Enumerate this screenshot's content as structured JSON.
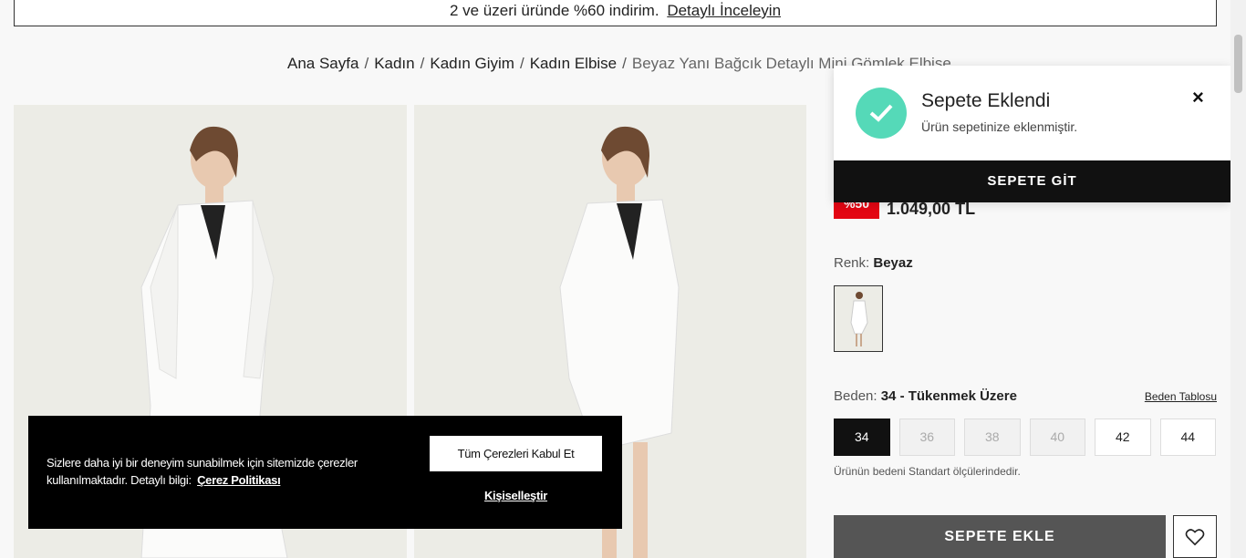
{
  "promo": {
    "text": "2 ve üzeri üründe %60 indirim.",
    "link": "Detaylı İnceleyin"
  },
  "breadcrumb": {
    "items": [
      "Ana Sayfa",
      "Kadın",
      "Kadın Giyim",
      "Kadın Elbise"
    ],
    "current": "Beyaz Yanı Bağcık Detaylı Mini Gömlek Elbise",
    "separator": "/"
  },
  "product": {
    "discount_badge": "%50",
    "price": "1.049,00 TL",
    "color_label": "Renk:",
    "color_value": "Beyaz",
    "size_label": "Beden:",
    "size_value": "34 - Tükenmek Üzere",
    "size_chart_link": "Beden Tablosu",
    "sizes": [
      {
        "label": "34",
        "state": "selected"
      },
      {
        "label": "36",
        "state": "disabled"
      },
      {
        "label": "38",
        "state": "disabled"
      },
      {
        "label": "40",
        "state": "disabled"
      },
      {
        "label": "42",
        "state": "available"
      },
      {
        "label": "44",
        "state": "available"
      }
    ],
    "size_note": "Ürünün bedeni Standart ölçülerindedir.",
    "add_to_cart": "SEPETE EKLE"
  },
  "toast": {
    "title": "Sepete Eklendi",
    "message": "Ürün sepetinize eklenmiştir.",
    "close": "×",
    "go_button": "SEPETE GİT"
  },
  "cookie": {
    "text": "Sizlere daha iyi bir deneyim sunabilmek için sitemizde çerezler kullanılmaktadır. Detaylı bilgi:",
    "policy_link": "Çerez Politikası",
    "accept_button": "Tüm Çerezleri Kabul Et",
    "customize_link": "Kişiselleştir"
  },
  "colors": {
    "accent_red": "#e30613",
    "success_green": "#55d9b8",
    "dark": "#111111"
  }
}
